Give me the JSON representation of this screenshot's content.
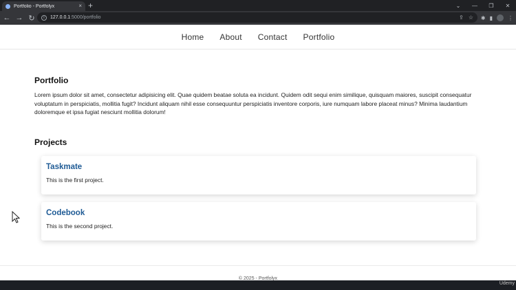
{
  "browser": {
    "tab_title": "Portfolio - Portfolyx",
    "tab_close": "×",
    "new_tab": "+",
    "url_host": "127.0.0.1",
    "url_path": ":5000/portfolio",
    "window_controls": [
      "⌄",
      "—",
      "❐",
      "✕"
    ]
  },
  "nav": {
    "items": [
      "Home",
      "About",
      "Contact",
      "Portfolio"
    ]
  },
  "main": {
    "heading": "Portfolio",
    "intro": "Lorem ipsum dolor sit amet, consectetur adipisicing elit. Quae quidem beatae soluta ea incidunt. Quidem odit sequi enim similique, quisquam maiores, suscipit consequatur voluptatum in perspiciatis, mollitia fugit? Incidunt aliquam nihil esse consequuntur perspiciatis inventore corporis, iure numquam labore placeat minus? Minima laudantium doloremque et ipsa fugiat nesciunt mollitia dolorum!",
    "projects_heading": "Projects",
    "projects": [
      {
        "title": "Taskmate",
        "desc": "This is the first project."
      },
      {
        "title": "Codebook",
        "desc": "This is the second project."
      }
    ]
  },
  "footer": {
    "text": "© 2025 - Portfolyx"
  },
  "overlay": {
    "watermark": "Udemy"
  },
  "colors": {
    "accent": "#1f5b95",
    "chrome_dark": "#202124",
    "chrome_toolbar": "#35363a"
  }
}
